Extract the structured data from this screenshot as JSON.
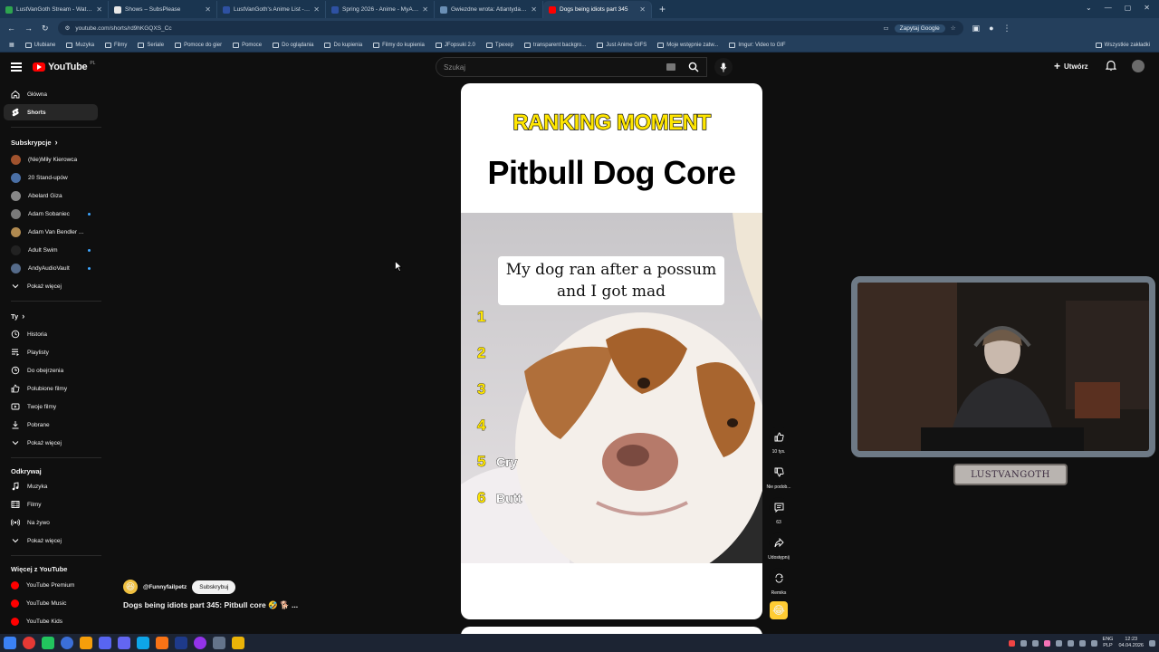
{
  "browser": {
    "tabs": [
      {
        "title": "LustVanGoth Stream - Watch Li",
        "color": "#2ea44f"
      },
      {
        "title": "Shows – SubsPlease",
        "color": "#e8e8e8"
      },
      {
        "title": "LustVanGoth's Anime List - My",
        "color": "#2e51a2"
      },
      {
        "title": "Spring 2026 - Anime - MyAnim",
        "color": "#2e51a2"
      },
      {
        "title": "Gwiezdne wrota: Atlantyda / St",
        "color": "#6a8fb5"
      },
      {
        "title": "Dogs being idiots part 345",
        "color": "#ff0000",
        "active": true
      }
    ],
    "url": "youtube.com/shorts/rd9hKGQXS_Cc",
    "ask_google": "Zapytaj Google",
    "bookmarks": [
      "Ulubiane",
      "Muzyka",
      "Filmy",
      "Seriale",
      "Pomoce do gier",
      "Pomoce",
      "Do oglądania",
      "Do kupienia",
      "Filmy do kupienia",
      "JFopsuki 2.0",
      "Tpexep",
      "transparent backgro...",
      "Just Anime GIFS",
      "Moje wstępnie zatw...",
      "Imgur: Video to GIF"
    ],
    "bookmarks_right": "Wszystkie zakładki"
  },
  "yt": {
    "logo_text": "YouTube",
    "logo_region": "PL",
    "search_placeholder": "Szukaj",
    "create_label": "Utwórz"
  },
  "sidebar": {
    "main": [
      {
        "label": "Główna",
        "icon": "home-icon"
      },
      {
        "label": "Shorts",
        "icon": "shorts-icon",
        "active": true
      }
    ],
    "subs_heading": "Subskrypcje",
    "subscriptions": [
      {
        "label": "(Nie)Miły Kierowca",
        "color": "#a0522d",
        "dot": false
      },
      {
        "label": "20 Stand-upów",
        "color": "#4a6fa5",
        "dot": false
      },
      {
        "label": "Abelard Giza",
        "color": "#888888",
        "dot": false
      },
      {
        "label": "Adam Sobaniec",
        "color": "#7a7a7a",
        "dot": true
      },
      {
        "label": "Adam Van Bendler ...",
        "color": "#b08a50",
        "dot": false
      },
      {
        "label": "Adult Swim",
        "color": "#222222",
        "dot": true
      },
      {
        "label": "AndyAudioVault",
        "color": "#556b8a",
        "dot": true
      }
    ],
    "show_more": "Pokaż więcej",
    "you_heading": "Ty",
    "you_items": [
      {
        "label": "Historia",
        "icon": "history-icon"
      },
      {
        "label": "Playlisty",
        "icon": "playlist-icon"
      },
      {
        "label": "Do obejrzenia",
        "icon": "clock-icon"
      },
      {
        "label": "Polubione filmy",
        "icon": "thumb-up-icon"
      },
      {
        "label": "Twoje filmy",
        "icon": "video-icon"
      },
      {
        "label": "Pobrane",
        "icon": "download-icon"
      }
    ],
    "explore_heading": "Odkrywaj",
    "explore_items": [
      {
        "label": "Muzyka",
        "icon": "music-icon"
      },
      {
        "label": "Filmy",
        "icon": "film-icon"
      },
      {
        "label": "Na żywo",
        "icon": "live-icon"
      }
    ],
    "more_heading": "Więcej z YouTube",
    "more_items": [
      {
        "label": "YouTube Premium",
        "color": "#ff0000"
      },
      {
        "label": "YouTube Music",
        "color": "#ff0000"
      },
      {
        "label": "YouTube Kids",
        "color": "#ff0000"
      }
    ]
  },
  "short": {
    "ranking_title": "RANKING MOMENT",
    "main_title": "Pitbull Dog Core",
    "caption": "My dog ran after a possum and I got mad",
    "ranks": [
      {
        "num": "1",
        "word": ""
      },
      {
        "num": "2",
        "word": ""
      },
      {
        "num": "3",
        "word": ""
      },
      {
        "num": "4",
        "word": ""
      },
      {
        "num": "5",
        "word": "Cry"
      },
      {
        "num": "6",
        "word": "Butt"
      }
    ],
    "channel": "@Funnyfailpetz",
    "subscribe_label": "Subskrybuj",
    "title": "Dogs being idiots part 345: Pitbull core 🤣 🐕 ..."
  },
  "actions": {
    "like_count": "10 tys.",
    "dislike_label": "Nie podob...",
    "comments_count": "63",
    "share_label": "Udostępnij",
    "remix_label": "Remiks"
  },
  "webcam": {
    "name_plate": "LUSTVANGOTH"
  },
  "taskbar": {
    "lang_top": "ENG",
    "lang_bottom": "PLP",
    "time": "12:23",
    "date": "04.04.2026"
  }
}
